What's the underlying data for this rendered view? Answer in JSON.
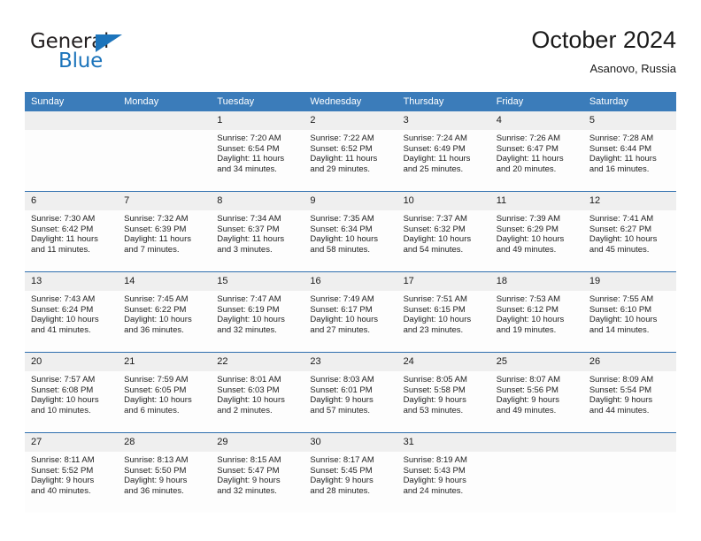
{
  "brand": {
    "name_part1": "General",
    "name_part2": "Blue",
    "logo_icon": "blue-triangle-icon"
  },
  "header": {
    "title": "October 2024",
    "subtitle": "Asanovo, Russia"
  },
  "colors": {
    "header_blue": "#3b7cba",
    "row_divider_blue": "#2f6fae",
    "daynum_band": "#efefef",
    "brand_blue": "#1c74bb",
    "text": "#1a1a1a"
  },
  "weekday_headers": [
    "Sunday",
    "Monday",
    "Tuesday",
    "Wednesday",
    "Thursday",
    "Friday",
    "Saturday"
  ],
  "labels": {
    "sunrise_prefix": "Sunrise:",
    "sunset_prefix": "Sunset:",
    "daylight_prefix": "Daylight:"
  },
  "weeks": [
    [
      {
        "day": "",
        "empty": true
      },
      {
        "day": "",
        "empty": true
      },
      {
        "day": "1",
        "sunrise": "Sunrise: 7:20 AM",
        "sunset": "Sunset: 6:54 PM",
        "daylight_l1": "Daylight: 11 hours",
        "daylight_l2": "and 34 minutes."
      },
      {
        "day": "2",
        "sunrise": "Sunrise: 7:22 AM",
        "sunset": "Sunset: 6:52 PM",
        "daylight_l1": "Daylight: 11 hours",
        "daylight_l2": "and 29 minutes."
      },
      {
        "day": "3",
        "sunrise": "Sunrise: 7:24 AM",
        "sunset": "Sunset: 6:49 PM",
        "daylight_l1": "Daylight: 11 hours",
        "daylight_l2": "and 25 minutes."
      },
      {
        "day": "4",
        "sunrise": "Sunrise: 7:26 AM",
        "sunset": "Sunset: 6:47 PM",
        "daylight_l1": "Daylight: 11 hours",
        "daylight_l2": "and 20 minutes."
      },
      {
        "day": "5",
        "sunrise": "Sunrise: 7:28 AM",
        "sunset": "Sunset: 6:44 PM",
        "daylight_l1": "Daylight: 11 hours",
        "daylight_l2": "and 16 minutes."
      }
    ],
    [
      {
        "day": "6",
        "sunrise": "Sunrise: 7:30 AM",
        "sunset": "Sunset: 6:42 PM",
        "daylight_l1": "Daylight: 11 hours",
        "daylight_l2": "and 11 minutes."
      },
      {
        "day": "7",
        "sunrise": "Sunrise: 7:32 AM",
        "sunset": "Sunset: 6:39 PM",
        "daylight_l1": "Daylight: 11 hours",
        "daylight_l2": "and 7 minutes."
      },
      {
        "day": "8",
        "sunrise": "Sunrise: 7:34 AM",
        "sunset": "Sunset: 6:37 PM",
        "daylight_l1": "Daylight: 11 hours",
        "daylight_l2": "and 3 minutes."
      },
      {
        "day": "9",
        "sunrise": "Sunrise: 7:35 AM",
        "sunset": "Sunset: 6:34 PM",
        "daylight_l1": "Daylight: 10 hours",
        "daylight_l2": "and 58 minutes."
      },
      {
        "day": "10",
        "sunrise": "Sunrise: 7:37 AM",
        "sunset": "Sunset: 6:32 PM",
        "daylight_l1": "Daylight: 10 hours",
        "daylight_l2": "and 54 minutes."
      },
      {
        "day": "11",
        "sunrise": "Sunrise: 7:39 AM",
        "sunset": "Sunset: 6:29 PM",
        "daylight_l1": "Daylight: 10 hours",
        "daylight_l2": "and 49 minutes."
      },
      {
        "day": "12",
        "sunrise": "Sunrise: 7:41 AM",
        "sunset": "Sunset: 6:27 PM",
        "daylight_l1": "Daylight: 10 hours",
        "daylight_l2": "and 45 minutes."
      }
    ],
    [
      {
        "day": "13",
        "sunrise": "Sunrise: 7:43 AM",
        "sunset": "Sunset: 6:24 PM",
        "daylight_l1": "Daylight: 10 hours",
        "daylight_l2": "and 41 minutes."
      },
      {
        "day": "14",
        "sunrise": "Sunrise: 7:45 AM",
        "sunset": "Sunset: 6:22 PM",
        "daylight_l1": "Daylight: 10 hours",
        "daylight_l2": "and 36 minutes."
      },
      {
        "day": "15",
        "sunrise": "Sunrise: 7:47 AM",
        "sunset": "Sunset: 6:19 PM",
        "daylight_l1": "Daylight: 10 hours",
        "daylight_l2": "and 32 minutes."
      },
      {
        "day": "16",
        "sunrise": "Sunrise: 7:49 AM",
        "sunset": "Sunset: 6:17 PM",
        "daylight_l1": "Daylight: 10 hours",
        "daylight_l2": "and 27 minutes."
      },
      {
        "day": "17",
        "sunrise": "Sunrise: 7:51 AM",
        "sunset": "Sunset: 6:15 PM",
        "daylight_l1": "Daylight: 10 hours",
        "daylight_l2": "and 23 minutes."
      },
      {
        "day": "18",
        "sunrise": "Sunrise: 7:53 AM",
        "sunset": "Sunset: 6:12 PM",
        "daylight_l1": "Daylight: 10 hours",
        "daylight_l2": "and 19 minutes."
      },
      {
        "day": "19",
        "sunrise": "Sunrise: 7:55 AM",
        "sunset": "Sunset: 6:10 PM",
        "daylight_l1": "Daylight: 10 hours",
        "daylight_l2": "and 14 minutes."
      }
    ],
    [
      {
        "day": "20",
        "sunrise": "Sunrise: 7:57 AM",
        "sunset": "Sunset: 6:08 PM",
        "daylight_l1": "Daylight: 10 hours",
        "daylight_l2": "and 10 minutes."
      },
      {
        "day": "21",
        "sunrise": "Sunrise: 7:59 AM",
        "sunset": "Sunset: 6:05 PM",
        "daylight_l1": "Daylight: 10 hours",
        "daylight_l2": "and 6 minutes."
      },
      {
        "day": "22",
        "sunrise": "Sunrise: 8:01 AM",
        "sunset": "Sunset: 6:03 PM",
        "daylight_l1": "Daylight: 10 hours",
        "daylight_l2": "and 2 minutes."
      },
      {
        "day": "23",
        "sunrise": "Sunrise: 8:03 AM",
        "sunset": "Sunset: 6:01 PM",
        "daylight_l1": "Daylight: 9 hours",
        "daylight_l2": "and 57 minutes."
      },
      {
        "day": "24",
        "sunrise": "Sunrise: 8:05 AM",
        "sunset": "Sunset: 5:58 PM",
        "daylight_l1": "Daylight: 9 hours",
        "daylight_l2": "and 53 minutes."
      },
      {
        "day": "25",
        "sunrise": "Sunrise: 8:07 AM",
        "sunset": "Sunset: 5:56 PM",
        "daylight_l1": "Daylight: 9 hours",
        "daylight_l2": "and 49 minutes."
      },
      {
        "day": "26",
        "sunrise": "Sunrise: 8:09 AM",
        "sunset": "Sunset: 5:54 PM",
        "daylight_l1": "Daylight: 9 hours",
        "daylight_l2": "and 44 minutes."
      }
    ],
    [
      {
        "day": "27",
        "sunrise": "Sunrise: 8:11 AM",
        "sunset": "Sunset: 5:52 PM",
        "daylight_l1": "Daylight: 9 hours",
        "daylight_l2": "and 40 minutes."
      },
      {
        "day": "28",
        "sunrise": "Sunrise: 8:13 AM",
        "sunset": "Sunset: 5:50 PM",
        "daylight_l1": "Daylight: 9 hours",
        "daylight_l2": "and 36 minutes."
      },
      {
        "day": "29",
        "sunrise": "Sunrise: 8:15 AM",
        "sunset": "Sunset: 5:47 PM",
        "daylight_l1": "Daylight: 9 hours",
        "daylight_l2": "and 32 minutes."
      },
      {
        "day": "30",
        "sunrise": "Sunrise: 8:17 AM",
        "sunset": "Sunset: 5:45 PM",
        "daylight_l1": "Daylight: 9 hours",
        "daylight_l2": "and 28 minutes."
      },
      {
        "day": "31",
        "sunrise": "Sunrise: 8:19 AM",
        "sunset": "Sunset: 5:43 PM",
        "daylight_l1": "Daylight: 9 hours",
        "daylight_l2": "and 24 minutes."
      },
      {
        "day": "",
        "empty": true
      },
      {
        "day": "",
        "empty": true
      }
    ]
  ]
}
